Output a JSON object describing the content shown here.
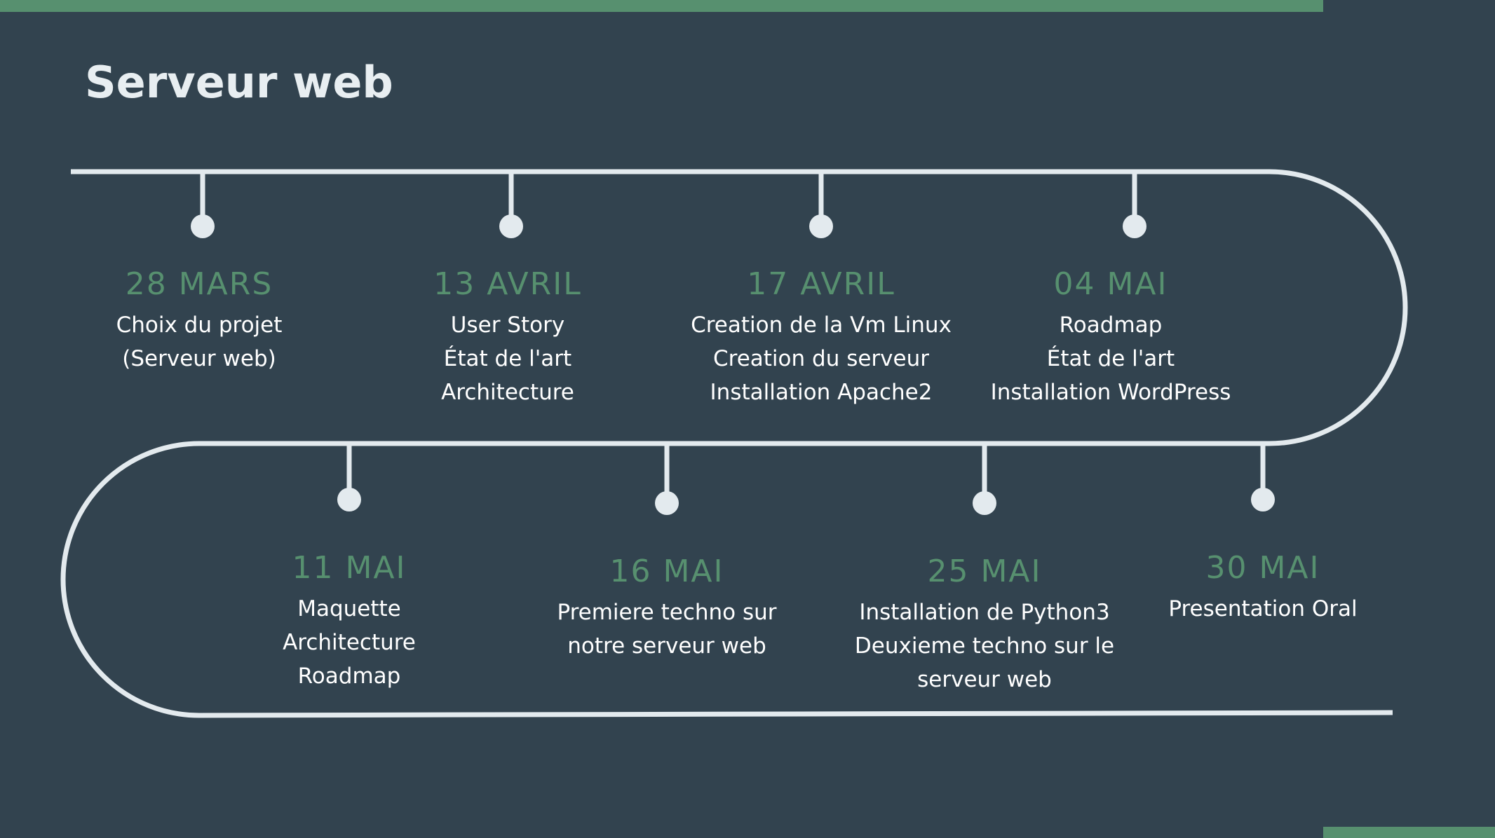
{
  "slide": {
    "title": "Serveur web",
    "colors": {
      "background": "#32434f",
      "accent": "#57906f",
      "line": "#e3eaee",
      "text": "#ffffff"
    }
  },
  "timeline": {
    "milestones": [
      {
        "date": "28 MARS",
        "lines": [
          "Choix du projet",
          "(Serveur web)"
        ]
      },
      {
        "date": "13 AVRIL",
        "lines": [
          "User Story",
          "État de l'art",
          "Architecture"
        ]
      },
      {
        "date": "17 AVRIL",
        "lines": [
          "Creation de la Vm Linux",
          "Creation du serveur",
          "Installation Apache2"
        ]
      },
      {
        "date": "04 MAI",
        "lines": [
          "Roadmap",
          "État de l'art",
          "Installation WordPress"
        ]
      },
      {
        "date": "11 MAI",
        "lines": [
          "Maquette",
          "Architecture",
          "Roadmap"
        ]
      },
      {
        "date": "16 MAI",
        "lines": [
          "Premiere techno sur",
          "notre serveur web"
        ]
      },
      {
        "date": "25 MAI",
        "lines": [
          "Installation de Python3",
          "Deuxieme techno sur le",
          "serveur web"
        ]
      },
      {
        "date": "30 MAI",
        "lines": [
          "Presentation Oral"
        ]
      }
    ]
  }
}
